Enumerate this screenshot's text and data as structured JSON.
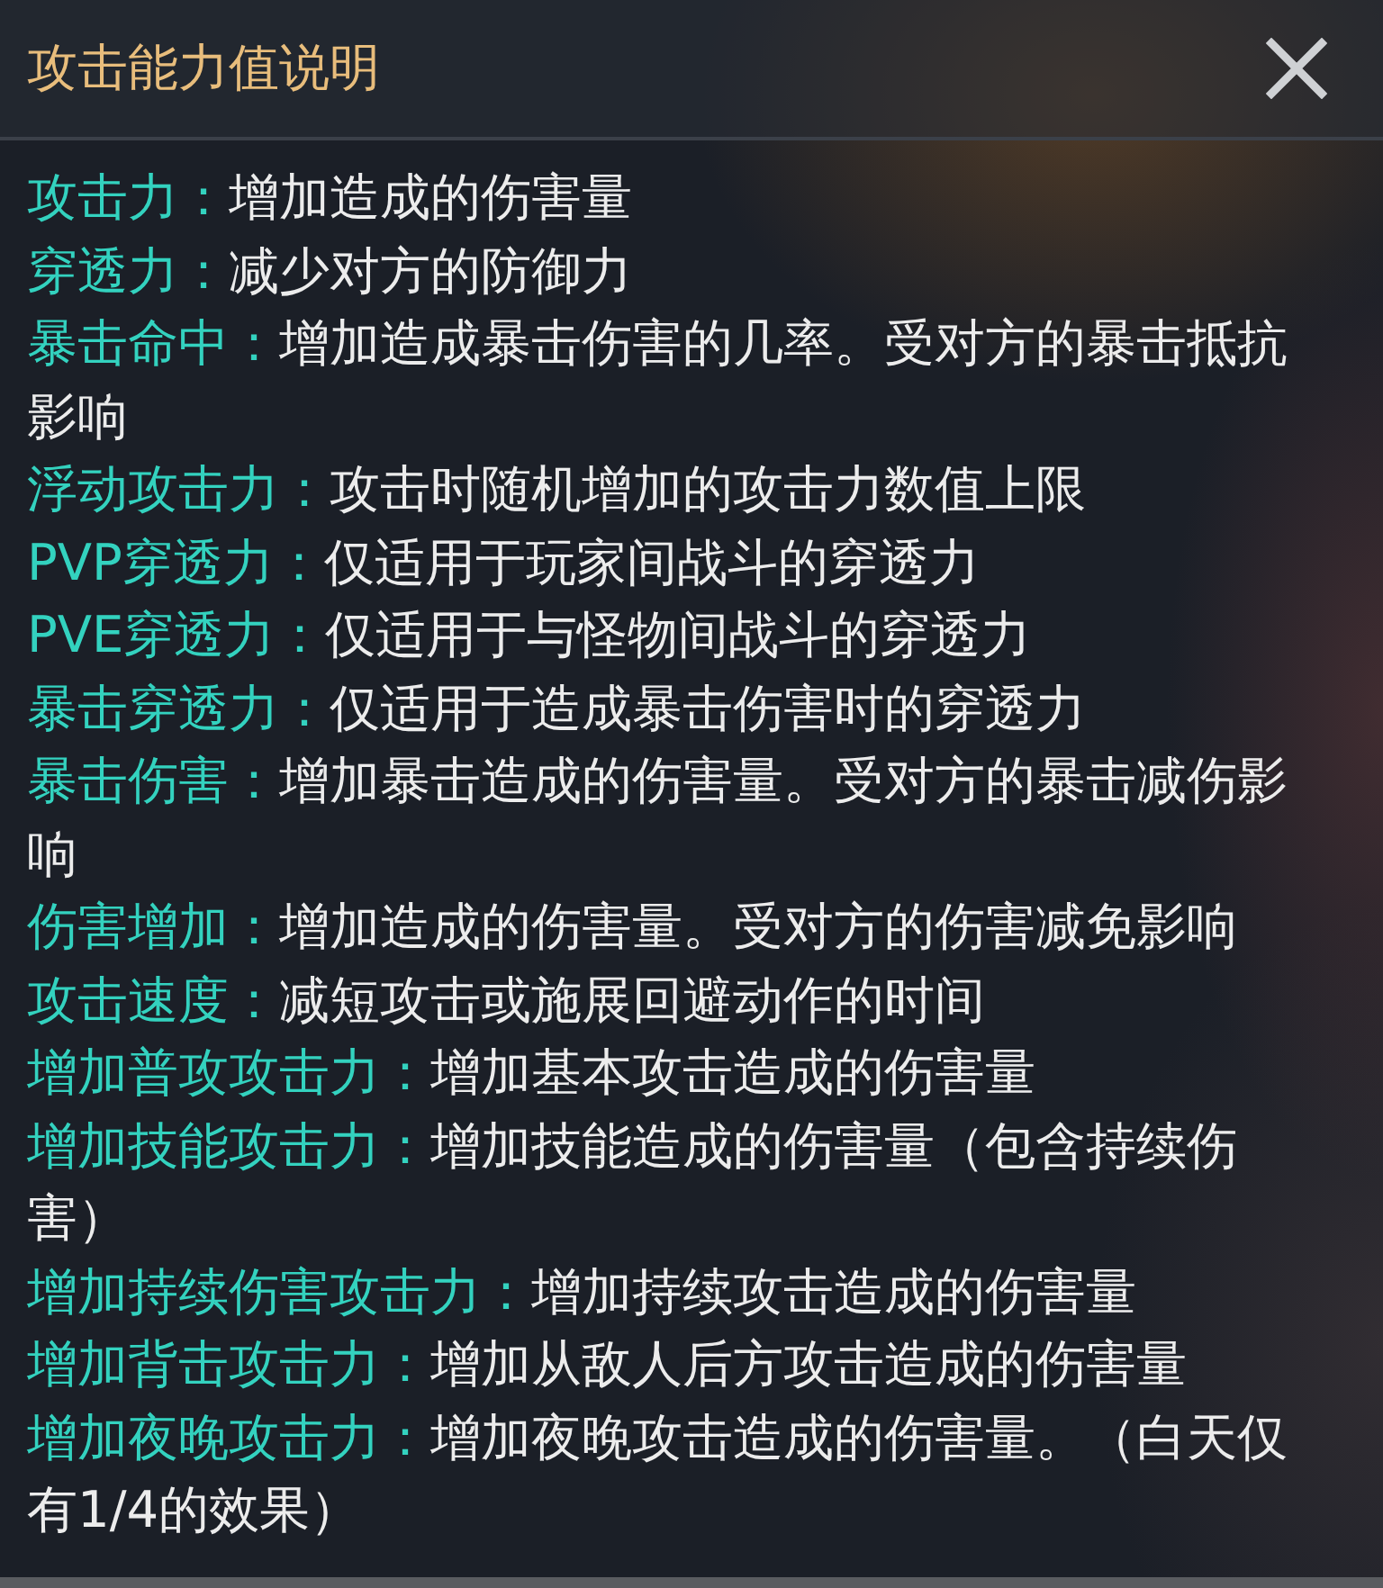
{
  "dialog": {
    "title": "攻击能力值说明",
    "entries": [
      {
        "term": "攻击力：",
        "description": "增加造成的伤害量"
      },
      {
        "term": "穿透力：",
        "description": "减少对方的防御力"
      },
      {
        "term": "暴击命中：",
        "description": "增加造成暴击伤害的几率。受对方的暴击抵抗影响"
      },
      {
        "term": "浮动攻击力：",
        "description": "攻击时随机增加的攻击力数值上限"
      },
      {
        "term": "PVP穿透力：",
        "description": "仅适用于玩家间战斗的穿透力"
      },
      {
        "term": "PVE穿透力：",
        "description": "仅适用于与怪物间战斗的穿透力"
      },
      {
        "term": "暴击穿透力：",
        "description": "仅适用于造成暴击伤害时的穿透力"
      },
      {
        "term": "暴击伤害：",
        "description": "增加暴击造成的伤害量。受对方的暴击减伤影响"
      },
      {
        "term": "伤害增加：",
        "description": "增加造成的伤害量。受对方的伤害减免影响"
      },
      {
        "term": "攻击速度：",
        "description": "减短攻击或施展回避动作的时间"
      },
      {
        "term": "增加普攻攻击力：",
        "description": "增加基本攻击造成的伤害量"
      },
      {
        "term": "增加技能攻击力：",
        "description": "增加技能造成的伤害量（包含持续伤害）"
      },
      {
        "term": "增加持续伤害攻击力：",
        "description": "增加持续攻击造成的伤害量"
      },
      {
        "term": "增加背击攻击力：",
        "description": "增加从敌人后方攻击造成的伤害量"
      },
      {
        "term": "增加夜晚攻击力：",
        "description": "增加夜晚攻击造成的伤害量。（白天仅有1/4的效果）"
      }
    ]
  }
}
